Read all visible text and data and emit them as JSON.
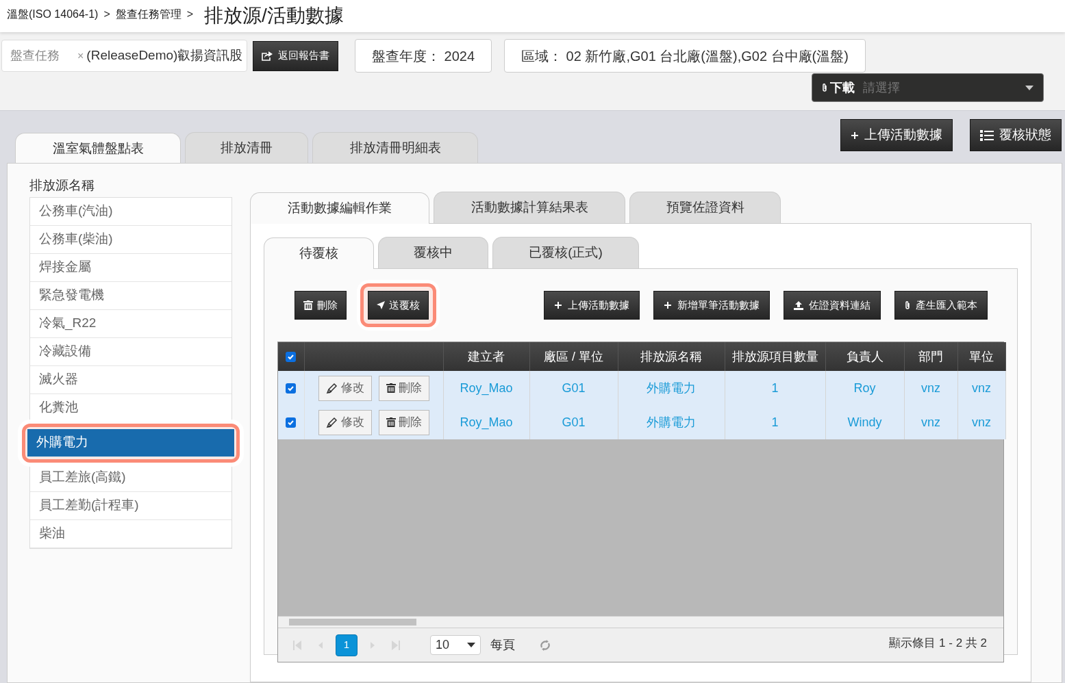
{
  "breadcrumb": {
    "items": [
      "溫盤(ISO 14064-1)",
      "盤查任務管理"
    ],
    "separator": ">",
    "title": "排放源/活動數據"
  },
  "filters": {
    "task": {
      "label": "盤查任務",
      "clear": "×",
      "value": "(ReleaseDemo)叡揚資訊股"
    },
    "back_button": "返回報告書",
    "year": "盤查年度： 2024",
    "region": "區域： 02 新竹廠,G01 台北廠(溫盤),G02 台中廠(溫盤)",
    "download": {
      "label": "下載",
      "placeholder": "請選擇"
    }
  },
  "header_buttons": [
    {
      "kind": "plus",
      "label": "上傳活動數據"
    },
    {
      "kind": "list",
      "label": "覆核狀態"
    }
  ],
  "main_tabs": [
    {
      "label": "溫室氣體盤點表",
      "selected": true
    },
    {
      "label": "排放清冊",
      "selected": false
    },
    {
      "label": "排放清冊明細表",
      "selected": false
    }
  ],
  "sidebar": {
    "title": "排放源名稱",
    "items": [
      {
        "label": "公務車(汽油)",
        "selected": false
      },
      {
        "label": "公務車(柴油)",
        "selected": false
      },
      {
        "label": "焊接金屬",
        "selected": false
      },
      {
        "label": "緊急發電機",
        "selected": false
      },
      {
        "label": "冷氣_R22",
        "selected": false
      },
      {
        "label": "冷藏設備",
        "selected": false
      },
      {
        "label": "滅火器",
        "selected": false
      },
      {
        "label": "化糞池",
        "selected": false
      },
      {
        "label": "外購電力",
        "selected": true,
        "highlighted": true
      },
      {
        "label": "員工差旅(高鐵)",
        "selected": false
      },
      {
        "label": "員工差勤(計程車)",
        "selected": false
      },
      {
        "label": "柴油",
        "selected": false
      }
    ]
  },
  "inner_tabs": [
    {
      "label": "活動數據編輯作業",
      "selected": true
    },
    {
      "label": "活動數據計算結果表",
      "selected": false
    },
    {
      "label": "預覽佐證資料",
      "selected": false
    }
  ],
  "review_tabs": [
    {
      "label": "待覆核",
      "selected": true
    },
    {
      "label": "覆核中",
      "selected": false
    },
    {
      "label": "已覆核(正式)",
      "selected": false
    }
  ],
  "toolbar_left": [
    {
      "kind": "trash",
      "label": "刪除",
      "highlighted": false
    },
    {
      "kind": "send",
      "label": "送覆核",
      "highlighted": true
    }
  ],
  "toolbar_right": [
    {
      "kind": "plus",
      "label": "上傳活動數據"
    },
    {
      "kind": "plus",
      "label": "新增單筆活動數據"
    },
    {
      "kind": "upload",
      "label": "佐證資料連結"
    },
    {
      "kind": "clip",
      "label": "產生匯入範本"
    }
  ],
  "table": {
    "all_checked": true,
    "columns": [
      "建立者",
      "廠區 / 單位",
      "排放源名稱",
      "排放源項目數量",
      "負責人",
      "部門",
      "單位"
    ],
    "rows": [
      {
        "checked": true,
        "actions": [
          {
            "kind": "edit",
            "label": "修改"
          },
          {
            "kind": "trash",
            "label": "刪除"
          }
        ],
        "cells": [
          "Roy_Mao",
          "G01",
          "外購電力",
          "1",
          "Roy",
          "vnz",
          "vnz"
        ]
      },
      {
        "checked": true,
        "actions": [
          {
            "kind": "edit",
            "label": "修改"
          },
          {
            "kind": "trash",
            "label": "刪除"
          }
        ],
        "cells": [
          "Roy_Mao",
          "G01",
          "外購電力",
          "1",
          "Windy",
          "vnz",
          "vnz"
        ]
      }
    ]
  },
  "pager": {
    "pages": [
      {
        "label": "1",
        "selected": true
      }
    ],
    "page_size": "10",
    "per_page": "每頁",
    "summary": "顯示條目 1 - 2 共 2"
  }
}
